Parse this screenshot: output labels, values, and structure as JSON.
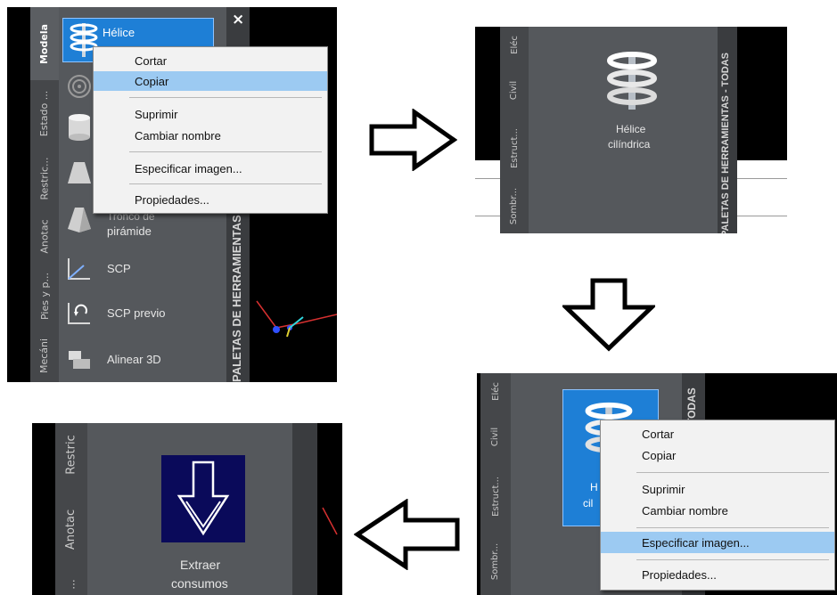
{
  "panel1": {
    "tabs": [
      "Modela",
      "Estado ...",
      "Restric...",
      "Anotac",
      "Pies y p...",
      "Mecáni"
    ],
    "selected_tool": "Hélice",
    "tools": [
      "Tronco de pirámide",
      "SCP",
      "SCP previo",
      "Alinear 3D"
    ],
    "tool_partial": "Tronco de",
    "tool_partial2": "pirámide",
    "close_glyph": "×",
    "palette_title": "PALETAS DE HERRAMIENTAS - TODAS",
    "menu": [
      "Cortar",
      "Copiar",
      "Suprimir",
      "Cambiar nombre",
      "Especificar imagen...",
      "Propiedades..."
    ],
    "highlighted": "Copiar"
  },
  "panel2": {
    "tabs": [
      "Eléc",
      "Civil",
      "Estruct...",
      "Sombr..."
    ],
    "tool_label_1": "Hélice",
    "tool_label_2": "cilíndrica",
    "palette_title": "PALETAS DE HERRAMIENTAS - TODAS"
  },
  "panel3": {
    "tabs": [
      "Eléc",
      "Civil",
      "Estruct...",
      "Sombr..."
    ],
    "tool_label_fragment_1": "H",
    "tool_label_fragment_2": "cil",
    "side_title": "TODAS",
    "menu": [
      "Cortar",
      "Copiar",
      "Suprimir",
      "Cambiar nombre",
      "Especificar imagen...",
      "Propiedades..."
    ],
    "highlighted": "Especificar imagen..."
  },
  "panel4": {
    "tabs": [
      "Restric",
      "Anotac",
      "..."
    ],
    "tool_label_1": "Extraer",
    "tool_label_2": "consumos"
  },
  "colors": {
    "highlight": "#9ccaf2",
    "selected_tool": "#1e7fd6",
    "palette_bg": "#55585c"
  }
}
